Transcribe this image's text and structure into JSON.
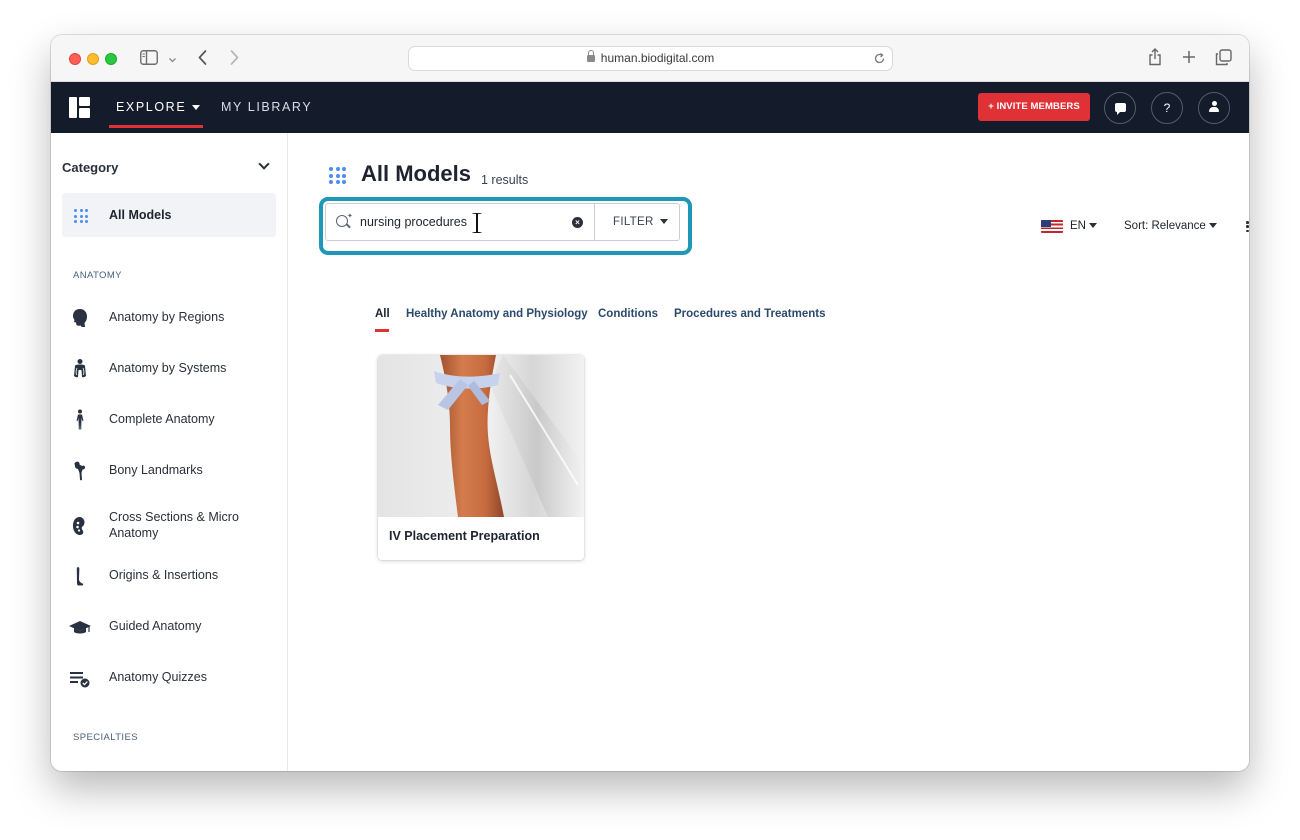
{
  "browser": {
    "url": "human.biodigital.com"
  },
  "header": {
    "nav": [
      "EXPLORE",
      "MY LIBRARY"
    ],
    "invite_label": "+ INVITE MEMBERS",
    "help_label": "?"
  },
  "sidebar": {
    "category_title": "Category",
    "all_models_label": "All Models",
    "anatomy_heading": "ANATOMY",
    "items": [
      {
        "label": "Anatomy by Regions",
        "icon": "head-icon"
      },
      {
        "label": "Anatomy by Systems",
        "icon": "lungs-body-icon"
      },
      {
        "label": "Complete Anatomy",
        "icon": "human-figure-icon"
      },
      {
        "label": "Bony Landmarks",
        "icon": "bone-icon"
      },
      {
        "label": "Cross Sections & Micro Anatomy",
        "icon": "kidney-section-icon"
      },
      {
        "label": "Origins & Insertions",
        "icon": "muscle-icon"
      },
      {
        "label": "Guided Anatomy",
        "icon": "graduation-cap-icon"
      },
      {
        "label": "Anatomy Quizzes",
        "icon": "quiz-list-icon"
      }
    ],
    "specialties_heading": "SPECIALTIES"
  },
  "main": {
    "title": "All Models",
    "results": "1 results",
    "search": {
      "value": "nursing procedures",
      "filter_label": "FILTER"
    },
    "language": "EN",
    "sort_label": "Sort: Relevance",
    "tabs": [
      "All",
      "Healthy Anatomy and Physiology",
      "Conditions",
      "Procedures and Treatments"
    ],
    "cards": [
      {
        "title": "IV Placement Preparation"
      }
    ]
  },
  "colors": {
    "accent_red": "#e03236",
    "header_bg": "#141c2c",
    "highlight_teal": "#1f97b6",
    "dots_blue": "#4b8ef0"
  }
}
